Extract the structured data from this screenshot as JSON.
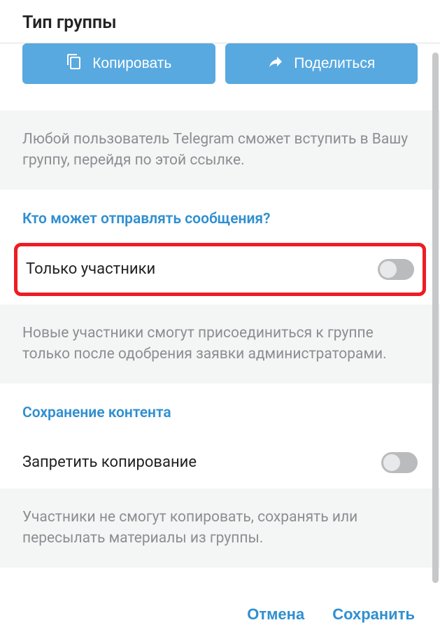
{
  "header": {
    "title": "Тип группы"
  },
  "buttons": {
    "copy": "Копировать",
    "share": "Поделиться"
  },
  "info1": "Любой пользователь Telegram сможет вступить в Вашу группу, перейдя по этой ссылке.",
  "section1": {
    "heading": "Кто может отправлять сообщения?",
    "row_label": "Только участники"
  },
  "info2": "Новые участники смогут присоединиться к группе только после одобрения заявки администраторами.",
  "section2": {
    "heading": "Сохранение контента",
    "row_label": "Запретить копирование"
  },
  "info3": "Участники не смогут копировать, сохранять или пересылать материалы из группы.",
  "footer": {
    "cancel": "Отмена",
    "save": "Сохранить"
  }
}
